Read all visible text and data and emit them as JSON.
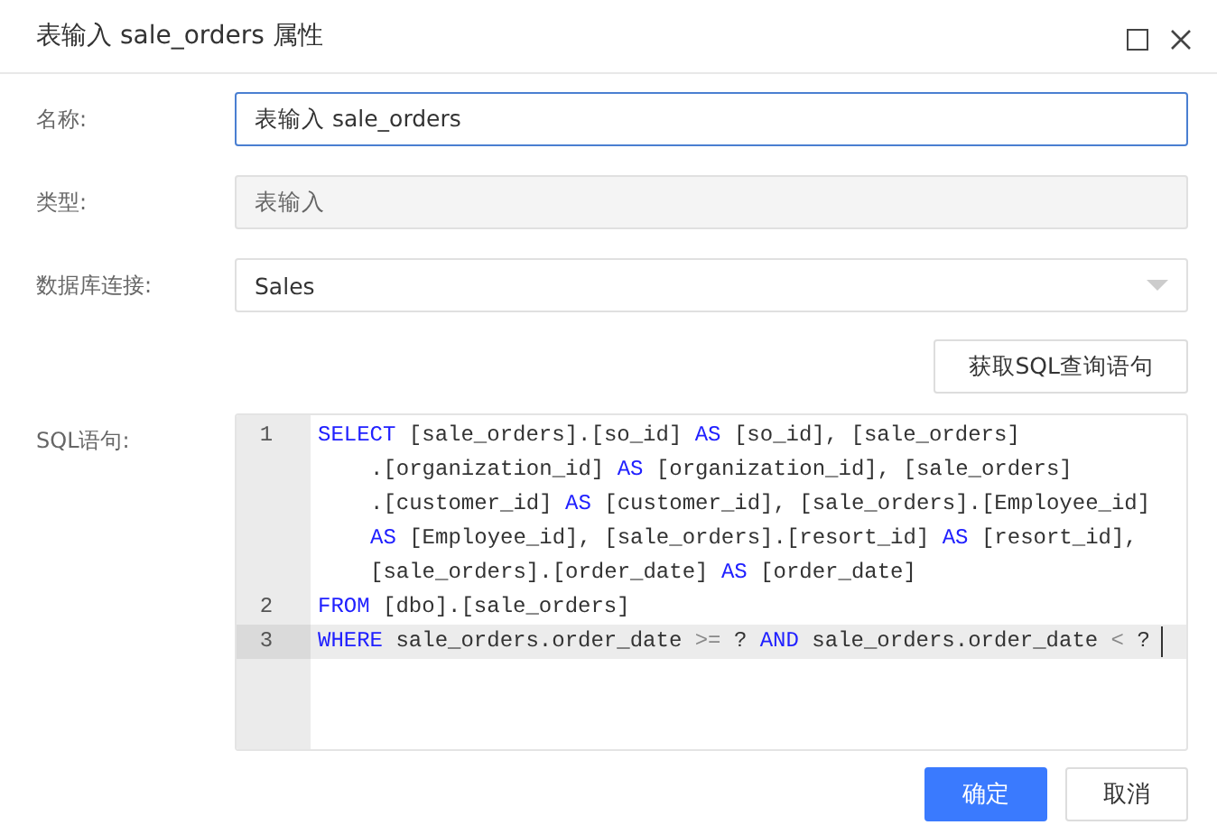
{
  "window": {
    "title": "表输入 sale_orders 属性"
  },
  "fields": [
    {
      "kind": "input",
      "label": "名称:",
      "value": "表输入 sale_orders",
      "focused": true,
      "disabled": false
    },
    {
      "kind": "input",
      "label": "类型:",
      "value": "表输入",
      "focused": false,
      "disabled": true
    },
    {
      "kind": "select",
      "label": "数据库连接:",
      "value": "Sales",
      "focused": false,
      "disabled": false
    }
  ],
  "fetch_button": "获取SQL查询语句",
  "sql": {
    "label": "SQL语句:",
    "lines": [
      {
        "number": "1",
        "active": false,
        "rows": [
          [
            {
              "kind": "keyword",
              "text": "SELECT"
            },
            {
              "kind": "plain",
              "text": " [sale_orders].[so_id] "
            },
            {
              "kind": "keyword",
              "text": "AS"
            },
            {
              "kind": "plain",
              "text": " [so_id], [sale_orders]"
            }
          ],
          [
            {
              "kind": "plain",
              "text": ".[organization_id] "
            },
            {
              "kind": "keyword",
              "text": "AS"
            },
            {
              "kind": "plain",
              "text": " [organization_id], [sale_orders]"
            }
          ],
          [
            {
              "kind": "plain",
              "text": ".[customer_id] "
            },
            {
              "kind": "keyword",
              "text": "AS"
            },
            {
              "kind": "plain",
              "text": " [customer_id], [sale_orders].[Employee_id]"
            }
          ],
          [
            {
              "kind": "keyword",
              "text": "AS"
            },
            {
              "kind": "plain",
              "text": " [Employee_id], [sale_orders].[resort_id] "
            },
            {
              "kind": "keyword",
              "text": "AS"
            },
            {
              "kind": "plain",
              "text": " [resort_id],"
            }
          ],
          [
            {
              "kind": "plain",
              "text": "[sale_orders].[order_date] "
            },
            {
              "kind": "keyword",
              "text": "AS"
            },
            {
              "kind": "plain",
              "text": " [order_date]"
            }
          ]
        ]
      },
      {
        "number": "2",
        "active": false,
        "rows": [
          [
            {
              "kind": "keyword",
              "text": "FROM"
            },
            {
              "kind": "plain",
              "text": " [dbo].[sale_orders]"
            }
          ]
        ]
      },
      {
        "number": "3",
        "active": true,
        "rows": [
          [
            {
              "kind": "keyword",
              "text": "WHERE"
            },
            {
              "kind": "plain",
              "text": " sale_orders.order_date "
            },
            {
              "kind": "operator",
              "text": ">="
            },
            {
              "kind": "plain",
              "text": " ? "
            },
            {
              "kind": "keyword",
              "text": "AND"
            },
            {
              "kind": "plain",
              "text": " sale_orders.order_date "
            },
            {
              "kind": "operator",
              "text": "<"
            },
            {
              "kind": "plain",
              "text": " ?"
            }
          ]
        ]
      }
    ]
  },
  "buttons": [
    {
      "label": "确定",
      "primary": true
    },
    {
      "label": "取消",
      "primary": false
    }
  ]
}
